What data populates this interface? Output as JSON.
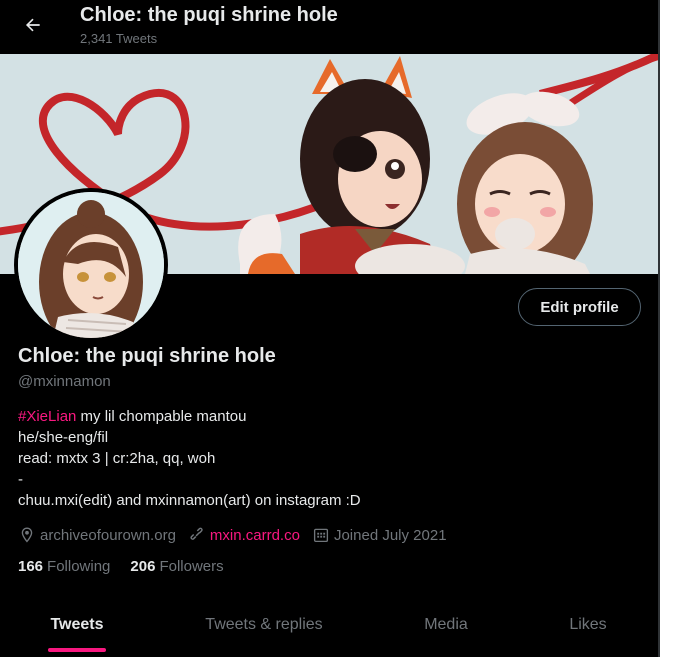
{
  "header": {
    "title": "Chloe: the puqi shrine hole",
    "tweet_count": "2,341 Tweets"
  },
  "profile": {
    "name": "Chloe: the puqi shrine hole",
    "handle": "@mxinnamon",
    "edit_label": "Edit profile",
    "bio": {
      "hashtag": "#XieLian",
      "line1_rest": " my lil chompable mantou",
      "line2": "he/she-eng/fil",
      "line3": "read: mxtx 3 | cr:2ha, qq, woh",
      "line4": "-",
      "line5": "chuu.mxi(edit) and mxinnamon(art) on instagram :D"
    },
    "location": "archiveofourown.org",
    "website": "mxin.carrd.co",
    "joined": "Joined July 2021",
    "following_count": "166",
    "following_label": "Following",
    "followers_count": "206",
    "followers_label": "Followers"
  },
  "tabs": [
    {
      "label": "Tweets",
      "active": true
    },
    {
      "label": "Tweets & replies",
      "active": false
    },
    {
      "label": "Media",
      "active": false
    },
    {
      "label": "Likes",
      "active": false
    }
  ],
  "colors": {
    "accent": "#f91880",
    "background": "#000000",
    "text": "#e7e9ea",
    "secondary_text": "#71767b",
    "banner_bg": "#d3e1e4"
  },
  "icons": {
    "back": "arrow-left-icon",
    "location": "location-pin-icon",
    "link": "link-icon",
    "calendar": "calendar-icon"
  }
}
